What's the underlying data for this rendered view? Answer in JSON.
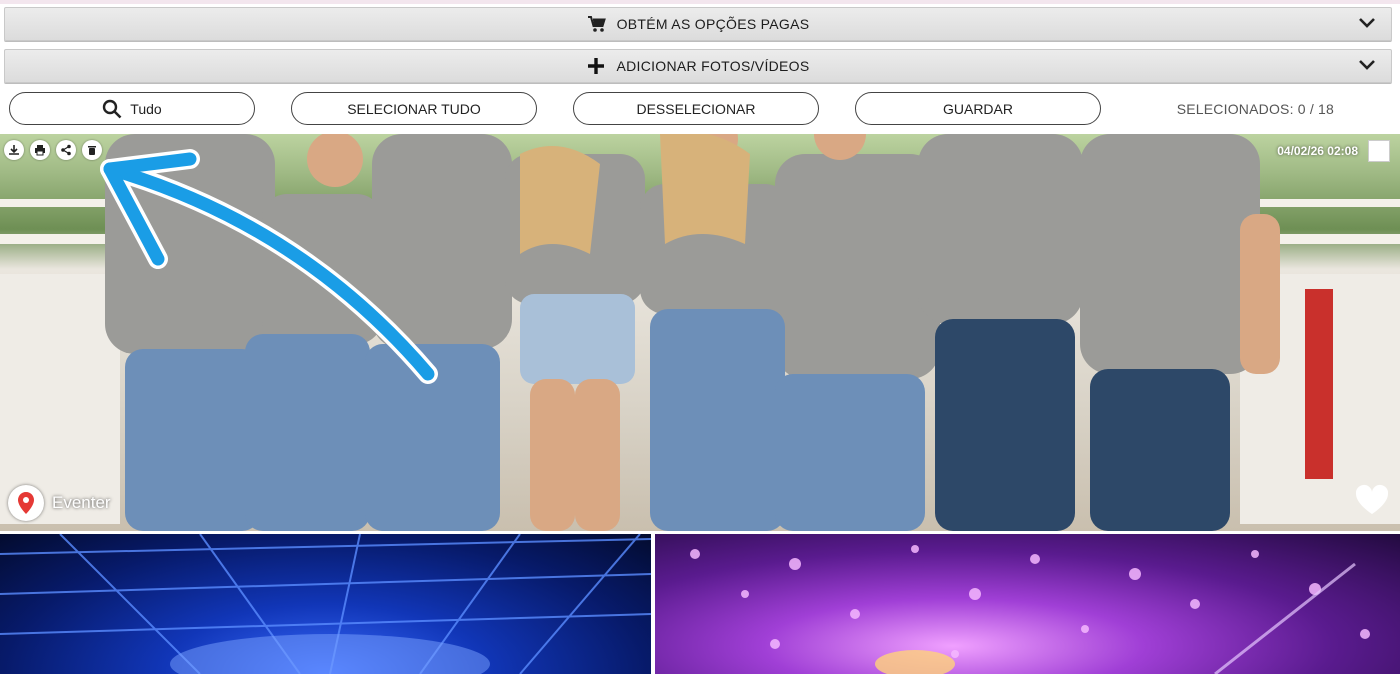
{
  "header": {
    "paid_options_label": "OBTÉM AS OPÇÕES PAGAS",
    "add_media_label": "ADICIONAR FOTOS/VÍDEOS"
  },
  "actions": {
    "filter_label": "Tudo",
    "select_all_label": "SELECIONAR TUDO",
    "deselect_label": "DESSELECIONAR",
    "save_label": "GUARDAR",
    "selected_count": "SELECIONADOS: 0 / 18"
  },
  "photo": {
    "timestamp": "04/02/26 02:08",
    "location_label": "Eventer",
    "tool_icons": [
      "download-icon",
      "print-icon",
      "share-icon",
      "trash-icon"
    ]
  },
  "colors": {
    "bar_bg": "#e2e2e2",
    "annotation_arrow": "#1a9de6",
    "location_pin": "#e53935"
  }
}
